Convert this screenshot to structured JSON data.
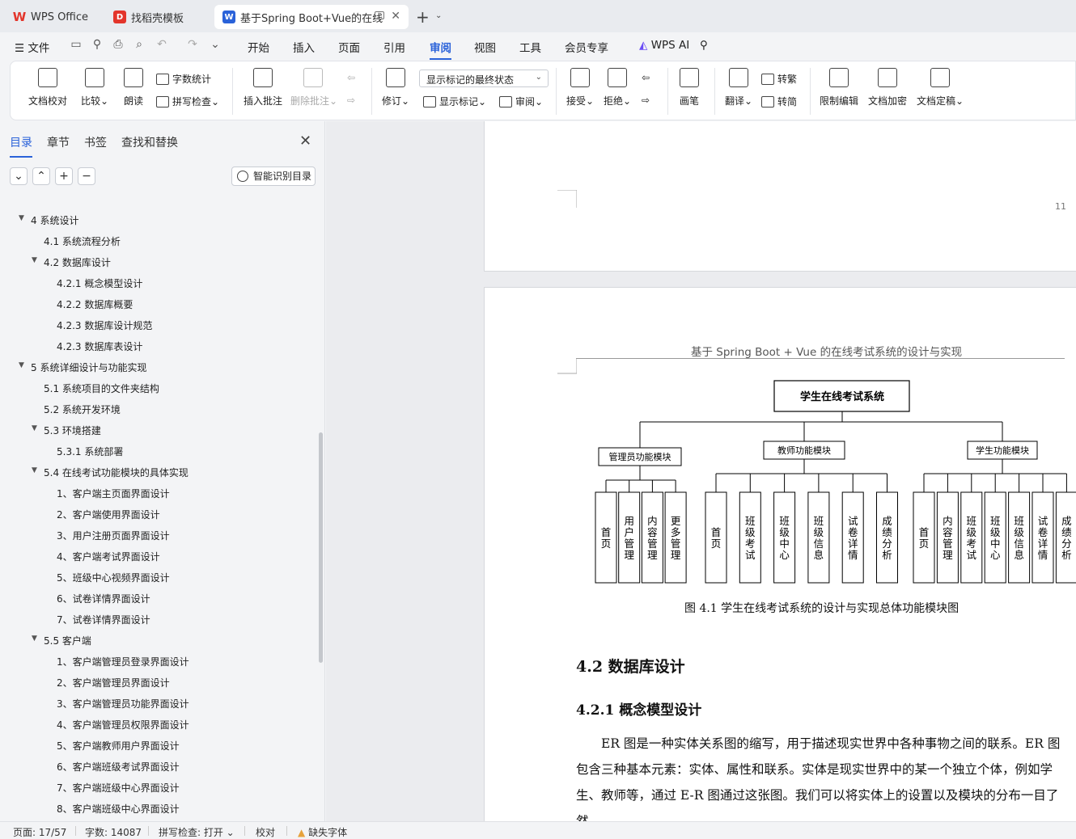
{
  "tabs": [
    {
      "label": "WPS Office",
      "icon": "wps-logo-icon",
      "color": "#e3352b"
    },
    {
      "label": "找稻壳模板",
      "icon": "docer-icon",
      "color": "#e3352b"
    },
    {
      "label": "基于Spring Boot+Vue的在线",
      "icon": "word-doc-icon",
      "color": "#2a62d9"
    }
  ],
  "menu": {
    "file": "文件",
    "items": [
      "开始",
      "插入",
      "页面",
      "引用",
      "审阅",
      "视图",
      "工具",
      "会员专享"
    ],
    "active": "审阅",
    "wps_ai": "WPS AI"
  },
  "ribbon": {
    "doc_check": "文档校对",
    "compare": "比较",
    "read": "朗读",
    "word_count": "字数统计",
    "spell_check": "拼写检查",
    "insert_comment": "插入批注",
    "delete_comment": "删除批注",
    "revise": "修订",
    "markup_state": "显示标记的最终状态",
    "show_markup": "显示标记",
    "review": "审阅",
    "accept": "接受",
    "reject": "拒绝",
    "pen": "画笔",
    "translate": "翻译",
    "to_traditional": "转繁",
    "to_simplified": "转简",
    "restrict_edit": "限制编辑",
    "encrypt": "文档加密",
    "finalize": "文档定稿"
  },
  "sidebar": {
    "tabs": [
      "目录",
      "章节",
      "书签",
      "查找和替换"
    ],
    "smart_toc": "智能识别目录",
    "toc": [
      {
        "label": "4 系统设计",
        "level": 1,
        "expanded": true
      },
      {
        "label": "4.1  系统流程分析",
        "level": 2
      },
      {
        "label": "4.2 数据库设计",
        "level": 2,
        "expanded": true
      },
      {
        "label": "4.2.1 概念模型设计",
        "level": 3
      },
      {
        "label": "4.2.2 数据库概要",
        "level": 3
      },
      {
        "label": "4.2.3 数据库设计规范",
        "level": 3
      },
      {
        "label": "4.2.3  数据库表设计",
        "level": 3
      },
      {
        "label": "5 系统详细设计与功能实现",
        "level": 1,
        "expanded": true
      },
      {
        "label": "5.1  系统项目的文件夹结构",
        "level": 2
      },
      {
        "label": "5.2 系统开发环境",
        "level": 2
      },
      {
        "label": "5.3 环境搭建",
        "level": 2,
        "expanded": true
      },
      {
        "label": "5.3.1 系统部署",
        "level": 3
      },
      {
        "label": "5.4 在线考试功能模块的具体实现",
        "level": 2,
        "expanded": true
      },
      {
        "label": "1、客户端主页面界面设计",
        "level": 3
      },
      {
        "label": "2、客户端使用界面设计",
        "level": 3
      },
      {
        "label": "3、用户注册页面界面设计",
        "level": 3
      },
      {
        "label": "4、客户端考试界面设计",
        "level": 3
      },
      {
        "label": "5、班级中心视频界面设计",
        "level": 3
      },
      {
        "label": "6、试卷详情界面设计",
        "level": 3
      },
      {
        "label": "7、试卷详情界面设计",
        "level": 3
      },
      {
        "label": "5.5  客户端",
        "level": 2,
        "expanded": true
      },
      {
        "label": "1、客户端管理员登录界面设计",
        "level": 3
      },
      {
        "label": "2、客户端管理员界面设计",
        "level": 3
      },
      {
        "label": "3、客户端管理员功能界面设计",
        "level": 3
      },
      {
        "label": "4、客户端管理员权限界面设计",
        "level": 3
      },
      {
        "label": "5、客户端教师用户界面设计",
        "level": 3
      },
      {
        "label": "6、客户端班级考试界面设计",
        "level": 3
      },
      {
        "label": "7、客户端班级中心界面设计",
        "level": 3
      },
      {
        "label": "8、客户端班级中心界面设计",
        "level": 3
      }
    ]
  },
  "document": {
    "page_number": "11",
    "header": "基于 Spring Boot + Vue 的在线考试系统的设计与实现",
    "diagram": {
      "root": "学生在线考试系统",
      "modules": [
        {
          "name": "管理员功能模块",
          "children": [
            "首页",
            "用户管理",
            "内容管理",
            "更多管理"
          ]
        },
        {
          "name": "教师功能模块",
          "children": [
            "首页",
            "班级考试",
            "班级中心",
            "班级信息",
            "试卷详情",
            "成绩分析"
          ]
        },
        {
          "name": "学生功能模块",
          "children": [
            "首页",
            "内容管理",
            "班级考试",
            "班级中心",
            "班级信息",
            "试卷详情",
            "成绩分析"
          ]
        }
      ]
    },
    "caption": "图 4.1  学生在线考试系统的设计与实现总体功能模块图",
    "h2": "4.2 数据库设计",
    "h3": "4.2.1 概念模型设计",
    "paragraph": "ER 图是一种实体关系图的缩写，用于描述现实世界中各种事物之间的联系。ER 图包含三种基本元素：实体、属性和联系。实体是现实世界中的某一个独立个体，例如学生、教师等，通过 E-R 图通过这张图。我们可以将实体上的设置以及模块的分布一目了然。"
  },
  "status": {
    "page": "页面: 17/57",
    "words": "字数: 14087",
    "spell": "拼写检查: 打开",
    "proof": "校对",
    "missing_font": "缺失字体"
  }
}
